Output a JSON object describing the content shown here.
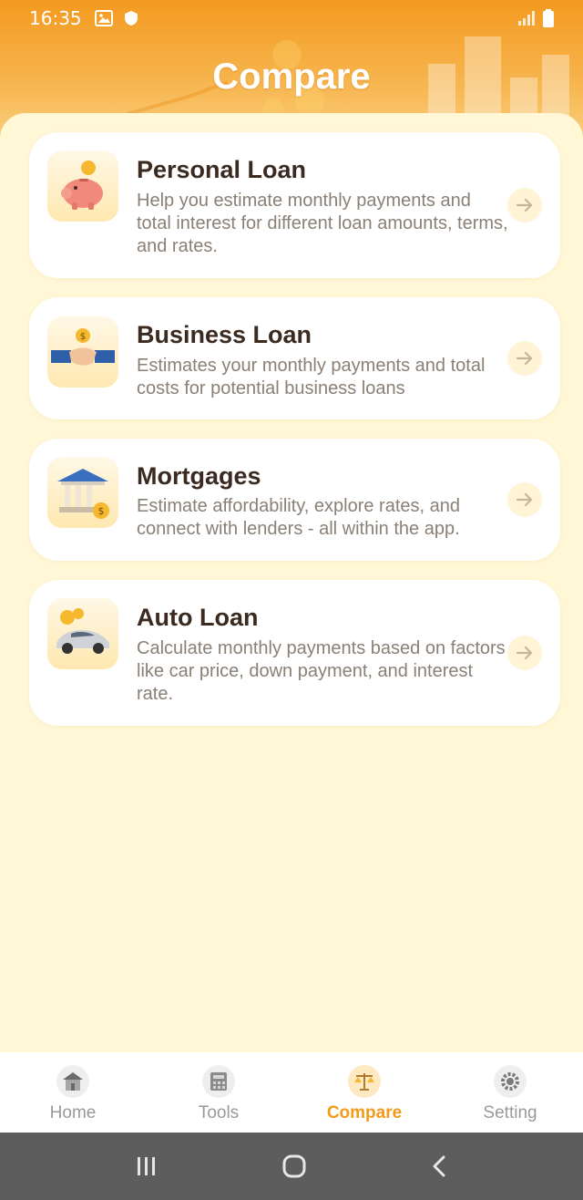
{
  "status_bar": {
    "time": "16:35"
  },
  "header": {
    "title": "Compare"
  },
  "cards": [
    {
      "title": "Personal Loan",
      "description": "Help you estimate monthly payments and total interest for different loan amounts, terms, and rates.",
      "icon": "piggy-bank-icon"
    },
    {
      "title": "Business Loan",
      "description": "Estimates your monthly payments and total costs for potential business loans",
      "icon": "handshake-icon"
    },
    {
      "title": "Mortgages",
      "description": "Estimate affordability, explore rates, and connect with lenders - all within the app.",
      "icon": "bank-building-icon"
    },
    {
      "title": "Auto Loan",
      "description": "Calculate monthly payments based on factors like car price, down payment, and interest rate.",
      "icon": "car-icon"
    }
  ],
  "bottom_nav": [
    {
      "label": "Home",
      "icon": "home-icon",
      "active": false
    },
    {
      "label": "Tools",
      "icon": "calculator-icon",
      "active": false
    },
    {
      "label": "Compare",
      "icon": "scales-icon",
      "active": true
    },
    {
      "label": "Setting",
      "icon": "gear-icon",
      "active": false
    }
  ],
  "colors": {
    "accent": "#f29a1a",
    "background": "#fff7d6",
    "title_text": "#3b2a1f",
    "desc_text": "#8a8076"
  }
}
